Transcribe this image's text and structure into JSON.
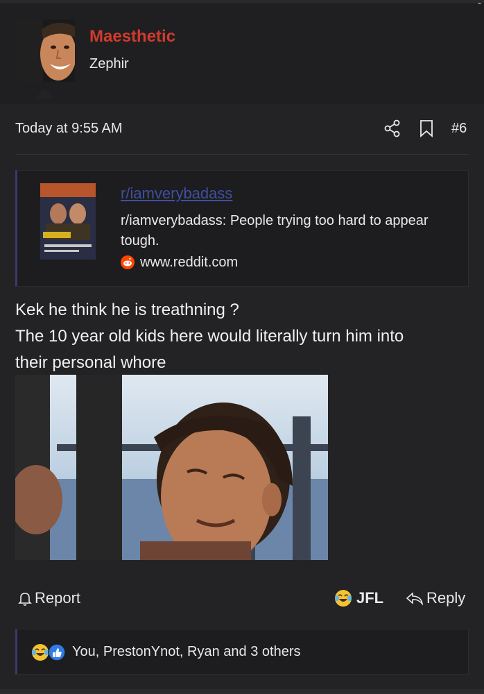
{
  "user": {
    "name": "Maesthetic",
    "title": "Zephir"
  },
  "post": {
    "timestamp": "Today at 9:55 AM",
    "number": "#6",
    "embed": {
      "title": "r/iamverybadass",
      "description": "r/iamverybadass: People trying too hard to appear tough.",
      "domain": "www.reddit.com"
    },
    "body_lines": [
      "Kek he think he is treathning ?",
      "The 10 year old kids here would literally turn him into",
      "their personal whore"
    ]
  },
  "actions": {
    "report_label": "Report",
    "reaction_label": "JFL",
    "reply_label": "Reply"
  },
  "reactions": {
    "text": "You, PrestonYnot, Ryan and 3 others",
    "icons": [
      "laughing-crying-emoji-icon",
      "thumbs-up-icon"
    ]
  },
  "colors": {
    "username": "#d33a2c",
    "link": "#3e4fa0",
    "accent_border": "#3a3a6e",
    "background": "#232325"
  }
}
